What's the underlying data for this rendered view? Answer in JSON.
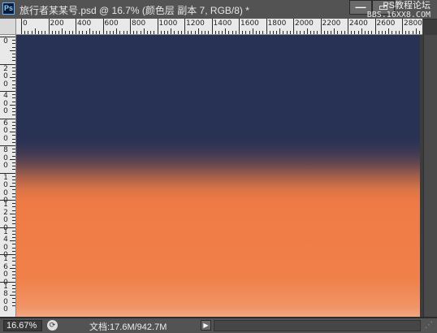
{
  "window": {
    "app_icon": "Ps",
    "title": "旅行者某某号.psd @ 16.7% (颜色层 副本 7, RGB/8) *",
    "minimize_glyph": "—",
    "close_glyph": "✕"
  },
  "watermark": {
    "line1": "PS教程论坛",
    "line2": "BBS.16XX8.COM"
  },
  "ruler_h": {
    "labels": [
      "0",
      "200",
      "400",
      "600",
      "800",
      "1000",
      "1200",
      "1400",
      "1600",
      "1800",
      "2000",
      "2200",
      "2400",
      "2600",
      "2800"
    ]
  },
  "ruler_v": {
    "labels": [
      "0",
      "2\n0\n0",
      "4\n0\n0",
      "6\n0\n0",
      "8\n0\n0",
      "1\n0\n0\n0",
      "1\n2\n0\n0",
      "1\n4\n0\n0",
      "1\n6\n0\n0",
      "1\n8\n0\n0"
    ]
  },
  "canvas": {
    "gradient_colors": [
      "#283254",
      "#6a4a4e",
      "#ef7a45",
      "#f2a883"
    ]
  },
  "status": {
    "zoom": "16.67%",
    "doc_size": "文档:17.6M/942.7M",
    "menu_arrow": "▶"
  }
}
